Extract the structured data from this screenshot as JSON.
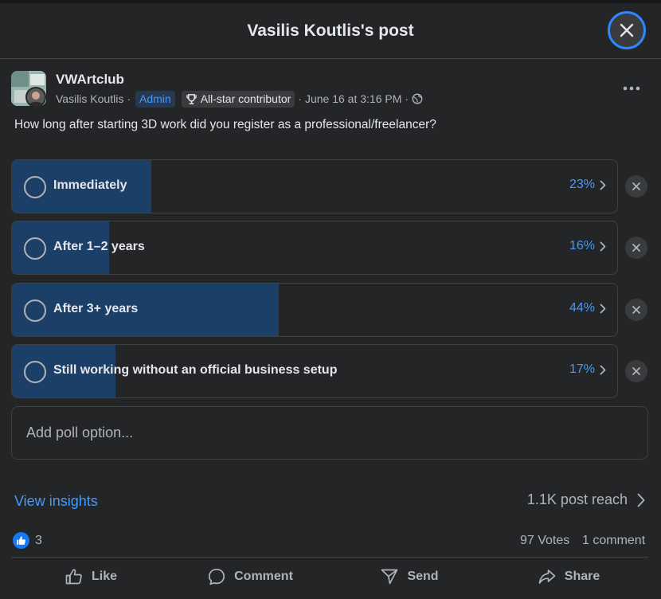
{
  "header": {
    "title": "Vasilis Koutlis's post"
  },
  "post": {
    "group_name": "VWArtclub",
    "author": "Vasilis Koutlis",
    "admin_badge": "Admin",
    "contributor_badge": "All-star contributor",
    "timestamp": "June 16 at 3:16 PM",
    "sep": "·",
    "question": "How long after starting 3D work did you register as a professional/freelancer?"
  },
  "poll": {
    "options": [
      {
        "label": "Immediately",
        "percent_text": "23%",
        "percent": 23
      },
      {
        "label": "After 1–2 years",
        "percent_text": "16%",
        "percent": 16
      },
      {
        "label": "After 3+ years",
        "percent_text": "44%",
        "percent": 44
      },
      {
        "label": "Still working without an official business setup",
        "percent_text": "17%",
        "percent": 17
      }
    ],
    "add_option_placeholder": "Add poll option..."
  },
  "insights": {
    "link": "View insights",
    "reach": "1.1K post reach"
  },
  "stats": {
    "likes": "3",
    "votes": "97 Votes",
    "comments": "1 comment"
  },
  "actions": {
    "like": "Like",
    "comment": "Comment",
    "send": "Send",
    "share": "Share"
  },
  "colors": {
    "accent": "#4599ff",
    "fill": "#1c3f68",
    "background": "#242526",
    "focus_ring": "#2d88ff"
  },
  "icons": [
    "close-icon",
    "trophy-icon",
    "globe-icon",
    "more-icon",
    "chevron-right-icon",
    "like-icon",
    "comment-icon",
    "send-icon",
    "share-icon"
  ]
}
